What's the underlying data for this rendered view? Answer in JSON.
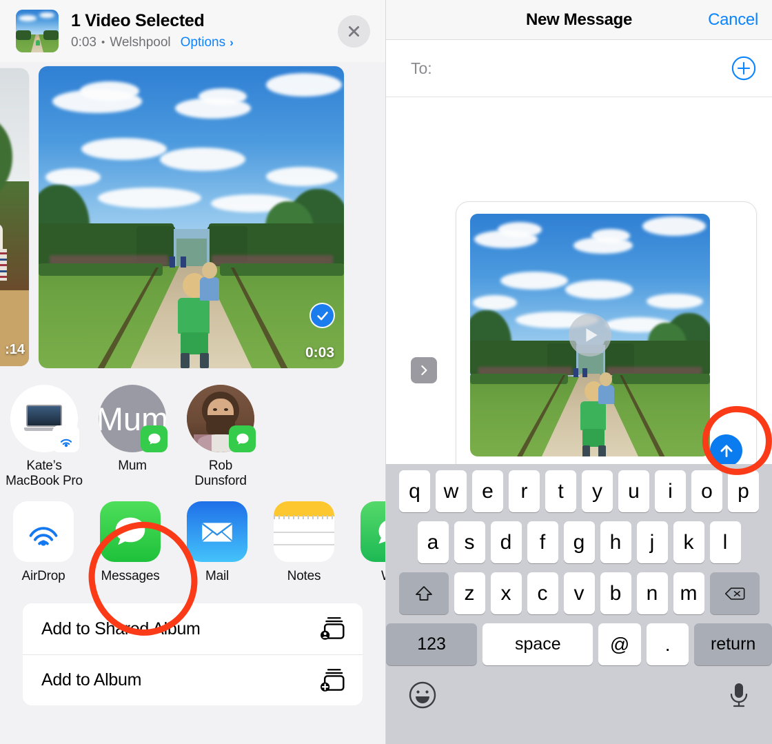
{
  "share_sheet": {
    "title": "1 Video Selected",
    "duration": "0:03",
    "separator": "•",
    "location": "Welshpool",
    "options_label": "Options",
    "options_chevron": "chevron-right-icon",
    "close_icon": "close-icon",
    "thumbnail_icon": "video-thumbnail",
    "photos": [
      {
        "duration": ":14",
        "selected": false,
        "name": "photo-thumbnail-previous"
      },
      {
        "duration": "0:03",
        "selected": true,
        "name": "photo-thumbnail-selected"
      }
    ],
    "contacts": [
      {
        "label": "Kate’s\nMacBook Pro",
        "line1": "Kate’s",
        "line2": "MacBook Pro",
        "avatar": "macbook-icon",
        "badge": "airdrop-icon"
      },
      {
        "label": "Mum",
        "line1": "Mum",
        "line2": "",
        "avatar": "initial-M",
        "badge": "messages-icon"
      },
      {
        "label": "Rob Dunsford",
        "line1": "Rob",
        "line2": "Dunsford",
        "avatar": "contact-photo",
        "badge": "messages-icon"
      }
    ],
    "apps": [
      {
        "label": "AirDrop",
        "icon": "airdrop-icon"
      },
      {
        "label": "Messages",
        "icon": "messages-icon",
        "highlighted": true
      },
      {
        "label": "Mail",
        "icon": "mail-icon"
      },
      {
        "label": "Notes",
        "icon": "notes-icon"
      },
      {
        "label": "Wh",
        "icon": "whatsapp-icon"
      }
    ],
    "actions": [
      {
        "label": "Add to Shared Album",
        "icon": "shared-album-icon"
      },
      {
        "label": "Add to Album",
        "icon": "add-album-icon"
      }
    ]
  },
  "messages": {
    "nav_title": "New Message",
    "cancel_label": "Cancel",
    "to_label": "To:",
    "add_contact_icon": "add-contact-icon",
    "attachment": {
      "type": "video",
      "play_icon": "play-icon",
      "expand_icon": "chevron-right-icon"
    },
    "send_icon": "send-arrow-up-icon",
    "keyboard": {
      "row1": [
        "q",
        "w",
        "e",
        "r",
        "t",
        "y",
        "u",
        "i",
        "o",
        "p"
      ],
      "row2": [
        "a",
        "s",
        "d",
        "f",
        "g",
        "h",
        "j",
        "k",
        "l"
      ],
      "row3": [
        "z",
        "x",
        "c",
        "v",
        "b",
        "n",
        "m"
      ],
      "shift_icon": "shift-icon",
      "delete_icon": "delete-backspace-icon",
      "numbers_label": "123",
      "space_label": "space",
      "at_label": "@",
      "dot_label": ".",
      "return_label": "return",
      "emoji_icon": "emoji-icon",
      "mic_icon": "microphone-icon"
    }
  },
  "annotations": {
    "color": "#fb3b18",
    "marks": [
      {
        "target": "messages-app-icon",
        "shape": "circle"
      },
      {
        "target": "send-button",
        "shape": "circle"
      }
    ]
  },
  "colors": {
    "accent_blue": "#0a84ff",
    "send_blue": "#0a7cf0",
    "annotation_red": "#fb3b18",
    "messages_green": "#1ec13b",
    "sheet_bg": "#f2f2f4",
    "keyboard_bg": "#cdced4"
  }
}
